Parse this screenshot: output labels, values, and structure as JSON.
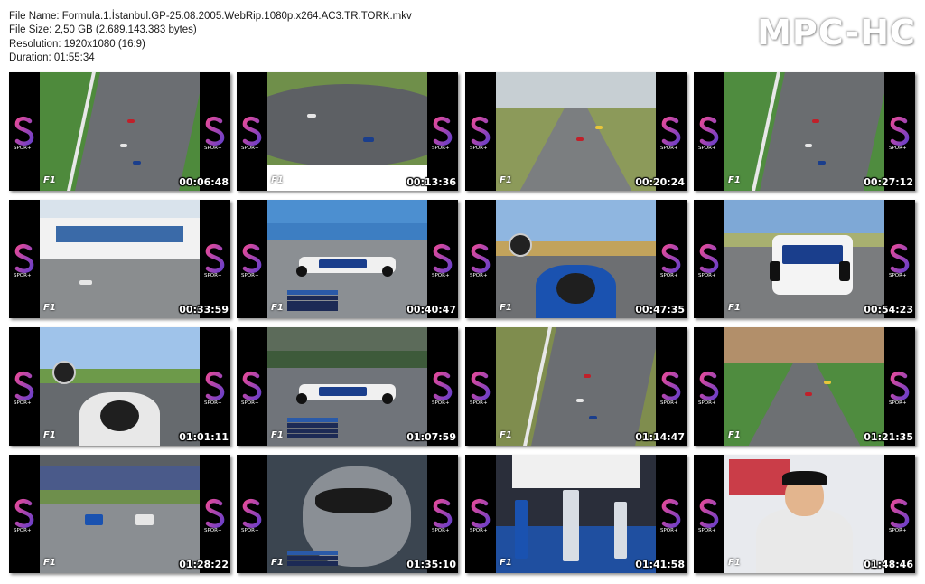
{
  "info": {
    "file_name": "File Name: Formula.1.İstanbul.GP-25.08.2005.WebRip.1080p.x264.AC3.TR.TORK.mkv",
    "file_size": "File Size: 2,50 GB (2.689.143.383 bytes)",
    "resolution": "Resolution: 1920x1080 (16:9)",
    "duration": "Duration: 01:55:34"
  },
  "brand": "MPC-HC",
  "thumbnails": [
    {
      "time": "00:06:48",
      "scene": "track-aerial",
      "colors": {
        "sky": "#b9c9d6",
        "ground": "#6b6e72",
        "grass": "#4e8a3c"
      }
    },
    {
      "time": "00:13:36",
      "scene": "track-curve",
      "colors": {
        "sky": "#9aa3a8",
        "ground": "#5d6064",
        "grass": "#6f8f4a"
      }
    },
    {
      "time": "00:20:24",
      "scene": "track-wide",
      "colors": {
        "sky": "#c7cfd3",
        "ground": "#7b7e80",
        "grass": "#8c9a5a"
      }
    },
    {
      "time": "00:27:12",
      "scene": "track-aerial",
      "colors": {
        "sky": "#b3c3cc",
        "ground": "#6a6d70",
        "grass": "#4f8c3f"
      }
    },
    {
      "time": "00:33:59",
      "scene": "pit-building",
      "colors": {
        "sky": "#d9e3ec",
        "ground": "#8a8d8f",
        "grass": "#9aa46a"
      }
    },
    {
      "time": "00:40:47",
      "scene": "car-side",
      "colors": {
        "sky": "#4c8fd0",
        "ground": "#8b8f93",
        "grass": "#3d7ec2"
      }
    },
    {
      "time": "00:47:35",
      "scene": "onboard",
      "colors": {
        "sky": "#8fb6e0",
        "ground": "#6d6f72",
        "grass": "#c2a35c"
      }
    },
    {
      "time": "00:54:23",
      "scene": "car-front",
      "colors": {
        "sky": "#7ea8d6",
        "ground": "#7a7c7e",
        "grass": "#a8b070"
      }
    },
    {
      "time": "01:01:11",
      "scene": "onboard-high",
      "colors": {
        "sky": "#9fc3ea",
        "ground": "#666a6e",
        "grass": "#6d9a4a"
      }
    },
    {
      "time": "01:07:59",
      "scene": "car-side",
      "colors": {
        "sky": "#5c6b5a",
        "ground": "#70747a",
        "grass": "#3d5a3a"
      }
    },
    {
      "time": "01:14:47",
      "scene": "track-aerial",
      "colors": {
        "sky": "#8d9a6a",
        "ground": "#6b6e72",
        "grass": "#7f8d4e"
      }
    },
    {
      "time": "01:21:35",
      "scene": "track-wide",
      "colors": {
        "sky": "#b28f6a",
        "ground": "#6d7073",
        "grass": "#4f8c3f"
      }
    },
    {
      "time": "01:28:22",
      "scene": "straight",
      "colors": {
        "sky": "#5a5f64",
        "ground": "#8a8e92",
        "grass": "#6e8f4c"
      }
    },
    {
      "time": "01:35:10",
      "scene": "helmet",
      "colors": {
        "sky": "#3b4550",
        "ground": "#2a2e33",
        "grass": "#8a8f95"
      }
    },
    {
      "time": "01:41:58",
      "scene": "podium",
      "colors": {
        "sky": "#2a2e3a",
        "ground": "#d8dde4",
        "grass": "#1f4fa0"
      }
    },
    {
      "time": "01:48:46",
      "scene": "press",
      "colors": {
        "sky": "#e8eaee",
        "ground": "#c9ccd2",
        "grass": "#c41e2a"
      }
    }
  ]
}
